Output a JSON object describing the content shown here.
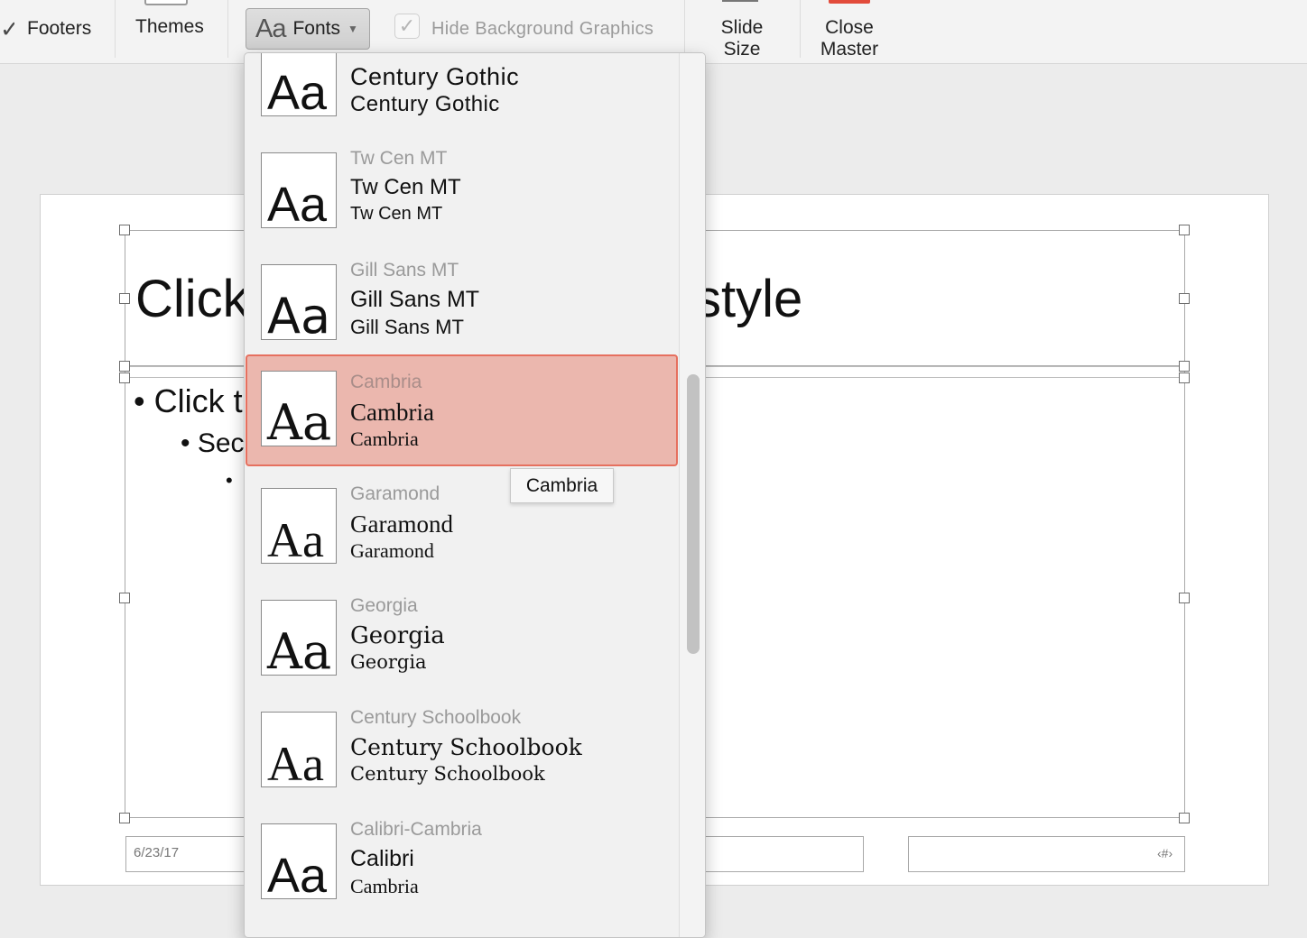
{
  "ribbon": {
    "footers_label": "Footers",
    "themes_label": "Themes",
    "fonts_icon_text": "Aa",
    "fonts_label": "Fonts",
    "hide_bg_label": "Hide Background Graphics",
    "slide_size_line1": "Slide",
    "slide_size_line2": "Size",
    "close_master_line1": "Close",
    "close_master_line2": "Master"
  },
  "slide": {
    "title_visible_start": "Click",
    "title_visible_end": "style",
    "body_level1": "Click t",
    "body_level2": "Sec",
    "body_level3": "•",
    "date": "6/23/17",
    "slide_number": "‹#›"
  },
  "font_list": {
    "items": [
      {
        "name": "",
        "heading": "Century Gothic",
        "body": "Century Gothic",
        "sample": "Aa"
      },
      {
        "name": "Tw Cen MT",
        "heading": "Tw Cen MT",
        "body": "Tw Cen MT",
        "sample": "Aa"
      },
      {
        "name": "Gill Sans MT",
        "heading": "Gill Sans MT",
        "body": "Gill Sans MT",
        "sample": "Aa"
      },
      {
        "name": "Cambria",
        "heading": "Cambria",
        "body": "Cambria",
        "sample": "Aa"
      },
      {
        "name": "Garamond",
        "heading": "Garamond",
        "body": "Garamond",
        "sample": "Aa"
      },
      {
        "name": "Georgia",
        "heading": "Georgia",
        "body": "Georgia",
        "sample": "Aa"
      },
      {
        "name": "Century Schoolbook",
        "heading": "Century Schoolbook",
        "body": "Century Schoolbook",
        "sample": "Aa"
      },
      {
        "name": "Calibri-Cambria",
        "heading": "Calibri",
        "body": "Cambria",
        "sample": "Aa"
      }
    ],
    "selected_tooltip": "Cambria"
  },
  "colors": {
    "selection_fill": "#ebb7ae",
    "selection_border": "#e6705f",
    "close_master_accent": "#e24b3b"
  },
  "icons": {
    "footers_checkbox": "checkmark-icon",
    "hide_bg_checkbox": "checkmark-icon",
    "fonts_dropdown": "chevron-down-icon"
  }
}
